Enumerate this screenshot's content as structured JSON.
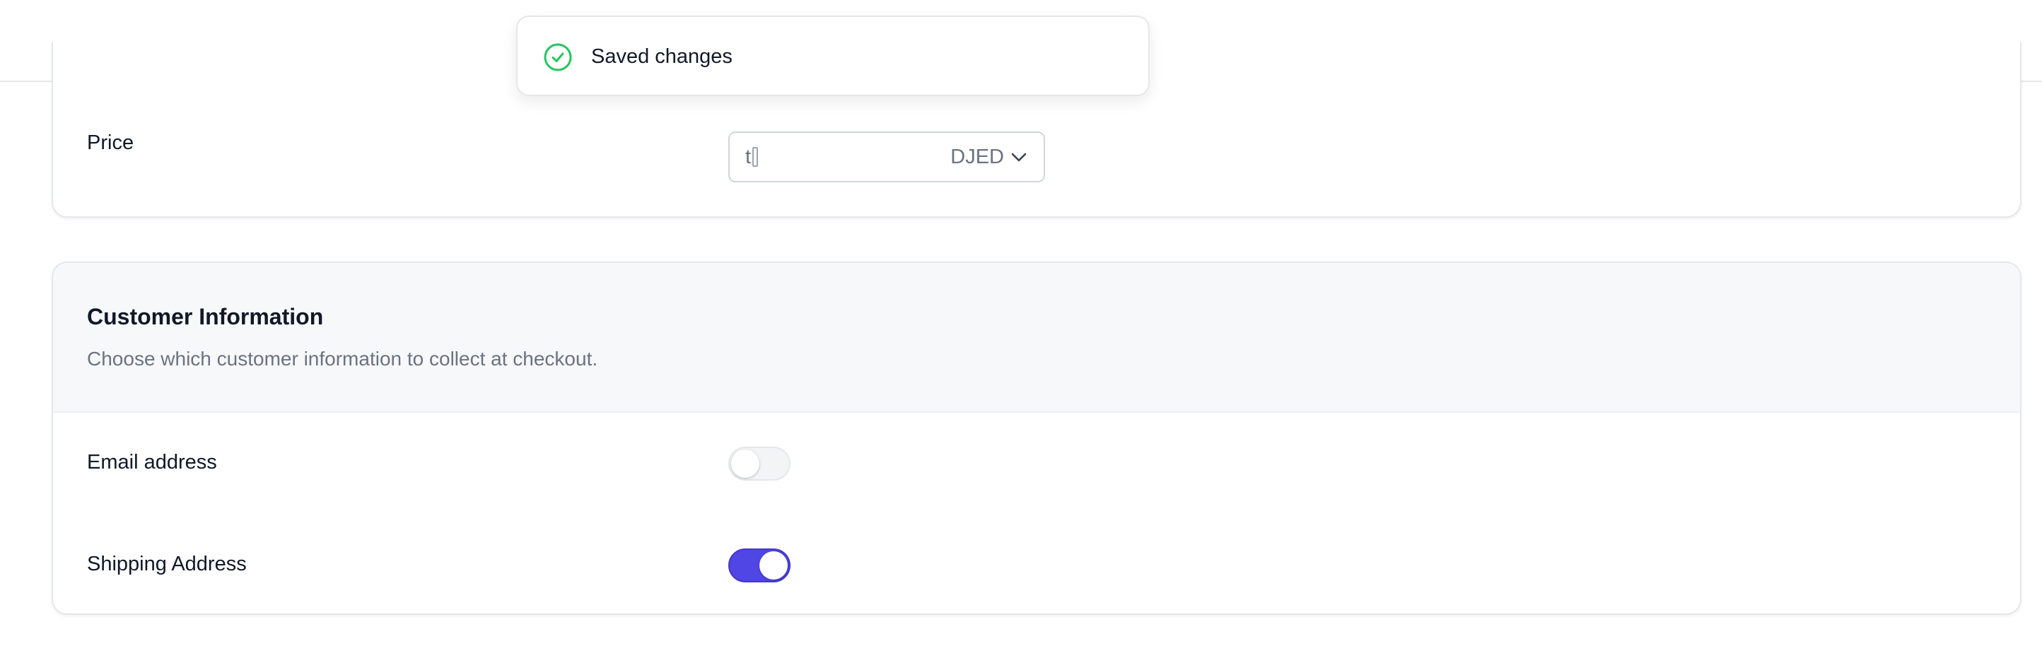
{
  "toast": {
    "message": "Saved changes",
    "icon": "check-circle-icon",
    "color": "#22c55e"
  },
  "price": {
    "label": "Price",
    "value": "t",
    "currency": "DJED",
    "currency_icon": "chevron-down-icon"
  },
  "customer_information": {
    "title": "Customer Information",
    "description": "Choose which customer information to collect at checkout.",
    "fields": [
      {
        "label": "Email address",
        "enabled": false
      },
      {
        "label": "Shipping Address",
        "enabled": true
      }
    ]
  },
  "colors": {
    "accent": "#4f46e5",
    "success": "#22c55e"
  }
}
